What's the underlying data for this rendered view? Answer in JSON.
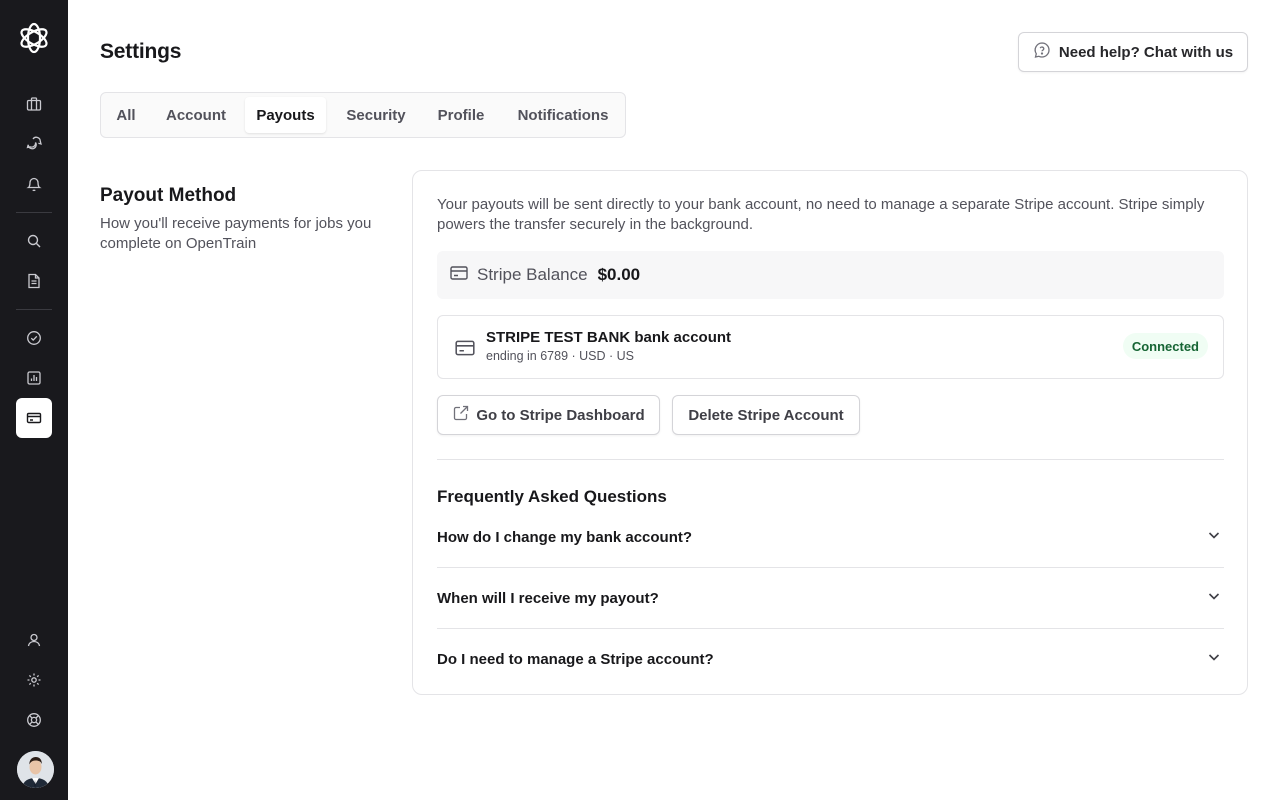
{
  "sidebar": {
    "logo": "flower-logo-icon",
    "items": [
      {
        "name": "briefcase-icon"
      },
      {
        "name": "messages-icon"
      },
      {
        "name": "bell-icon"
      },
      {
        "name": "search-icon"
      },
      {
        "name": "document-icon"
      },
      {
        "name": "check-circle-icon"
      },
      {
        "name": "chart-icon"
      },
      {
        "name": "payment-card-icon",
        "active": true
      },
      {
        "name": "user-icon"
      },
      {
        "name": "gear-icon"
      },
      {
        "name": "lifebuoy-icon"
      }
    ],
    "avatar": "user-avatar"
  },
  "header": {
    "title": "Settings",
    "help_label": "Need help? Chat with us"
  },
  "tabs": [
    {
      "label": "All"
    },
    {
      "label": "Account"
    },
    {
      "label": "Payouts",
      "active": true
    },
    {
      "label": "Security"
    },
    {
      "label": "Profile"
    },
    {
      "label": "Notifications"
    }
  ],
  "section": {
    "title": "Payout Method",
    "description": "How you'll receive payments for jobs you complete on OpenTrain"
  },
  "card": {
    "intro": "Your payouts will be sent directly to your bank account, no need to manage a separate Stripe account. Stripe simply powers the transfer securely in the background.",
    "balance_label": "Stripe Balance",
    "balance_value": "$0.00",
    "bank_name": "STRIPE TEST BANK bank account",
    "bank_detail": "ending in 6789 · USD · US",
    "status": "Connected",
    "dashboard_label": "Go to Stripe Dashboard",
    "delete_label": "Delete Stripe Account",
    "faq_title": "Frequently Asked Questions",
    "faq": [
      {
        "question": "How do I change my bank account?"
      },
      {
        "question": "When will I receive my payout?"
      },
      {
        "question": "Do I need to manage a Stripe account?"
      }
    ]
  },
  "colors": {
    "sidebar_bg": "#19191d",
    "status_green": "#166534",
    "status_bg": "#f0fdf4"
  }
}
